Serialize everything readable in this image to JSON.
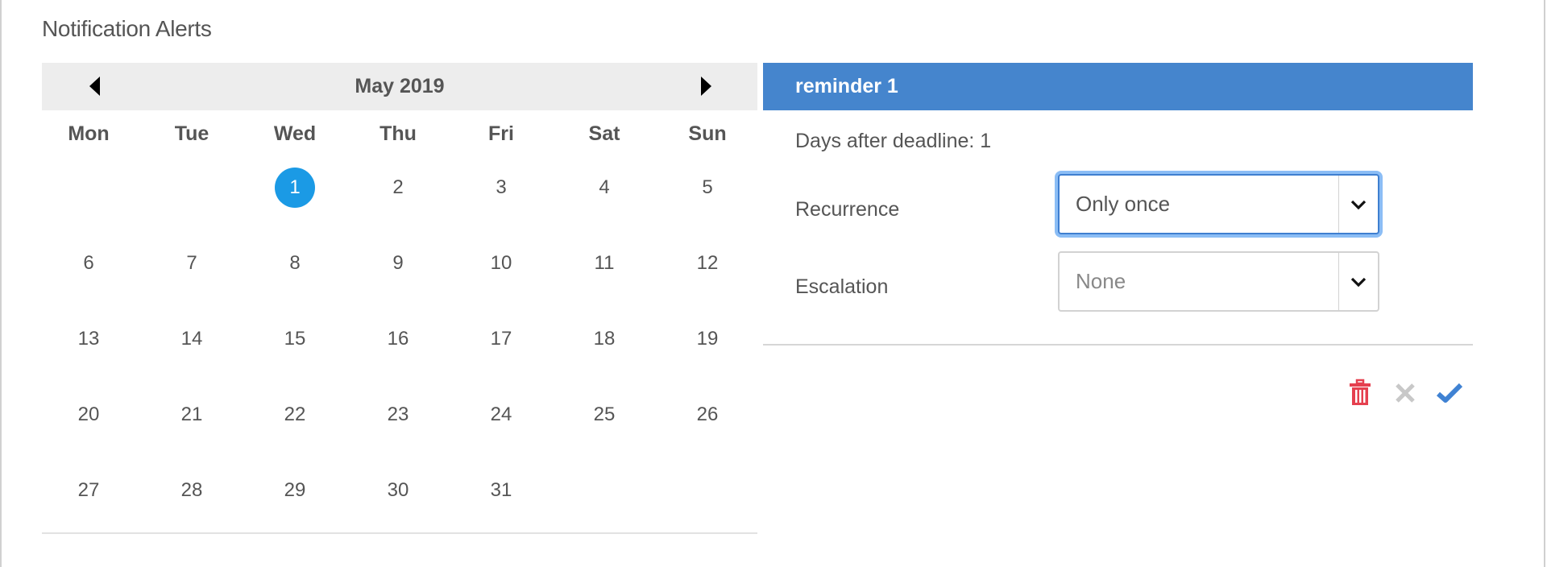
{
  "page": {
    "title": "Notification Alerts"
  },
  "calendar": {
    "month_label": "May 2019",
    "prev_label": "previous-month",
    "next_label": "next-month",
    "weekdays": [
      "Mon",
      "Tue",
      "Wed",
      "Thu",
      "Fri",
      "Sat",
      "Sun"
    ],
    "leading_empty_days": 2,
    "days": [
      "1",
      "2",
      "3",
      "4",
      "5",
      "6",
      "7",
      "8",
      "9",
      "10",
      "11",
      "12",
      "13",
      "14",
      "15",
      "16",
      "17",
      "18",
      "19",
      "20",
      "21",
      "22",
      "23",
      "24",
      "25",
      "26",
      "27",
      "28",
      "29",
      "30",
      "31"
    ],
    "selected_day": "1",
    "selected_color": "#1b9ae5"
  },
  "reminder": {
    "title": "reminder 1",
    "header_color": "#4585cd",
    "days_after_deadline": "Days after deadline: 1",
    "recurrence": {
      "label": "Recurrence",
      "value": "Only once",
      "icon": "chevron-down-icon"
    },
    "escalation": {
      "label": "Escalation",
      "placeholder": "None",
      "icon": "chevron-down-icon"
    },
    "actions": [
      {
        "name": "delete",
        "icon": "trash-icon",
        "color": "#e5404f"
      },
      {
        "name": "cancel",
        "icon": "close-icon",
        "color": "#c8c8c8"
      },
      {
        "name": "confirm",
        "icon": "check-icon",
        "color": "#3f82d3"
      }
    ]
  }
}
